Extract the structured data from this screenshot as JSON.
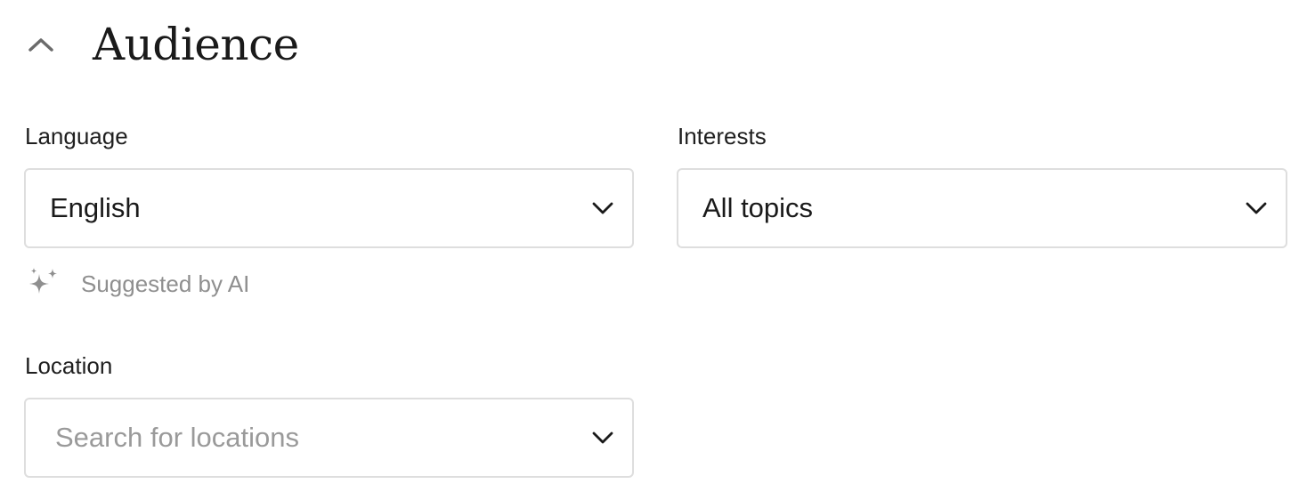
{
  "section": {
    "title": "Audience",
    "collapse_icon": "chevron-up-icon"
  },
  "language": {
    "label": "Language",
    "value": "English",
    "icon": "chevron-down-icon",
    "hint": {
      "icon": "sparkles-icon",
      "text": "Suggested by AI"
    }
  },
  "interests": {
    "label": "Interests",
    "value": "All topics",
    "icon": "chevron-down-icon"
  },
  "location": {
    "label": "Location",
    "placeholder": "Search for locations",
    "icon": "chevron-down-icon"
  },
  "colors": {
    "border": "#dedede",
    "text": "#1a1a1a",
    "muted": "#9a9a9a"
  }
}
